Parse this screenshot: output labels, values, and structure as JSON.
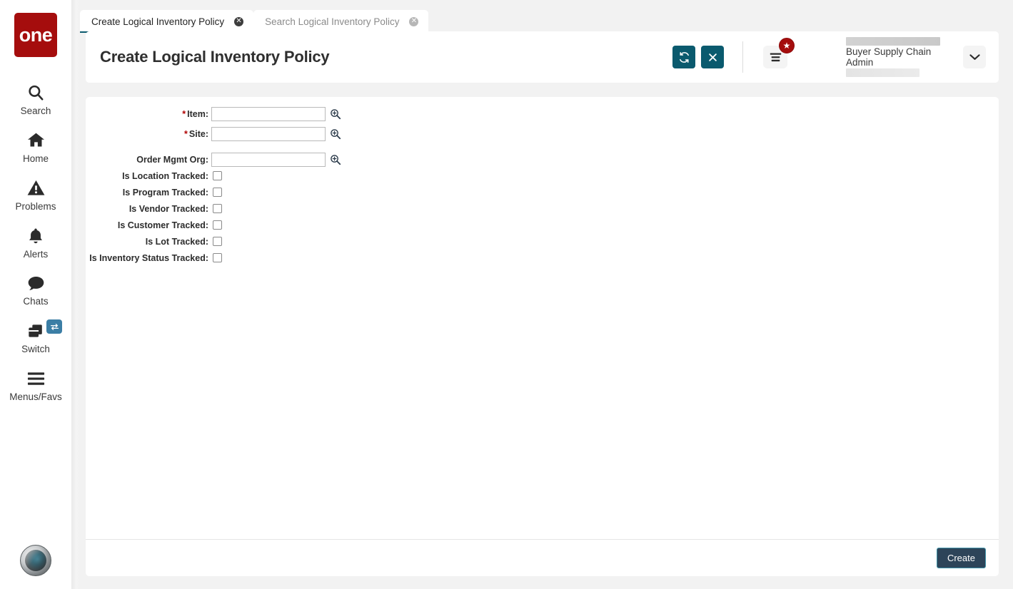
{
  "app": {
    "logo_text": "one",
    "brand_color": "#a50d0d",
    "accent_color": "#0a5a6e"
  },
  "sidebar": {
    "items": [
      {
        "label": "Search",
        "icon": "search-icon"
      },
      {
        "label": "Home",
        "icon": "home-icon"
      },
      {
        "label": "Problems",
        "icon": "warning-triangle-icon"
      },
      {
        "label": "Alerts",
        "icon": "bell-icon"
      },
      {
        "label": "Chats",
        "icon": "chat-bubble-icon"
      },
      {
        "label": "Switch",
        "icon": "switch-windows-icon"
      },
      {
        "label": "Menus/Favs",
        "icon": "hamburger-icon"
      }
    ]
  },
  "tabs": [
    {
      "label": "Create Logical Inventory Policy",
      "active": true
    },
    {
      "label": "Search Logical Inventory Policy",
      "active": false
    }
  ],
  "header": {
    "title": "Create Logical Inventory Policy",
    "refresh_label": "Refresh",
    "close_label": "Close",
    "menu_label": "Menu",
    "badge_glyph": "★",
    "user_name": "Buyer Supply Chain Admin",
    "caret_glyph": "⌄"
  },
  "form": {
    "fields": [
      {
        "label": "Item",
        "required": true,
        "type": "lookup",
        "value": "",
        "placeholder": ""
      },
      {
        "label": "Site",
        "required": true,
        "type": "lookup",
        "value": "",
        "placeholder": ""
      },
      {
        "label": "Order Mgmt Org",
        "required": false,
        "type": "lookup",
        "value": "",
        "placeholder": ""
      },
      {
        "label": "Is Location Tracked",
        "required": false,
        "type": "checkbox",
        "checked": false
      },
      {
        "label": "Is Program Tracked",
        "required": false,
        "type": "checkbox",
        "checked": false
      },
      {
        "label": "Is Vendor Tracked",
        "required": false,
        "type": "checkbox",
        "checked": false
      },
      {
        "label": "Is Customer Tracked",
        "required": false,
        "type": "checkbox",
        "checked": false
      },
      {
        "label": "Is Lot Tracked",
        "required": false,
        "type": "checkbox",
        "checked": false
      },
      {
        "label": "Is Inventory Status Tracked",
        "required": false,
        "type": "checkbox",
        "checked": false
      }
    ]
  },
  "footer": {
    "create_label": "Create"
  }
}
